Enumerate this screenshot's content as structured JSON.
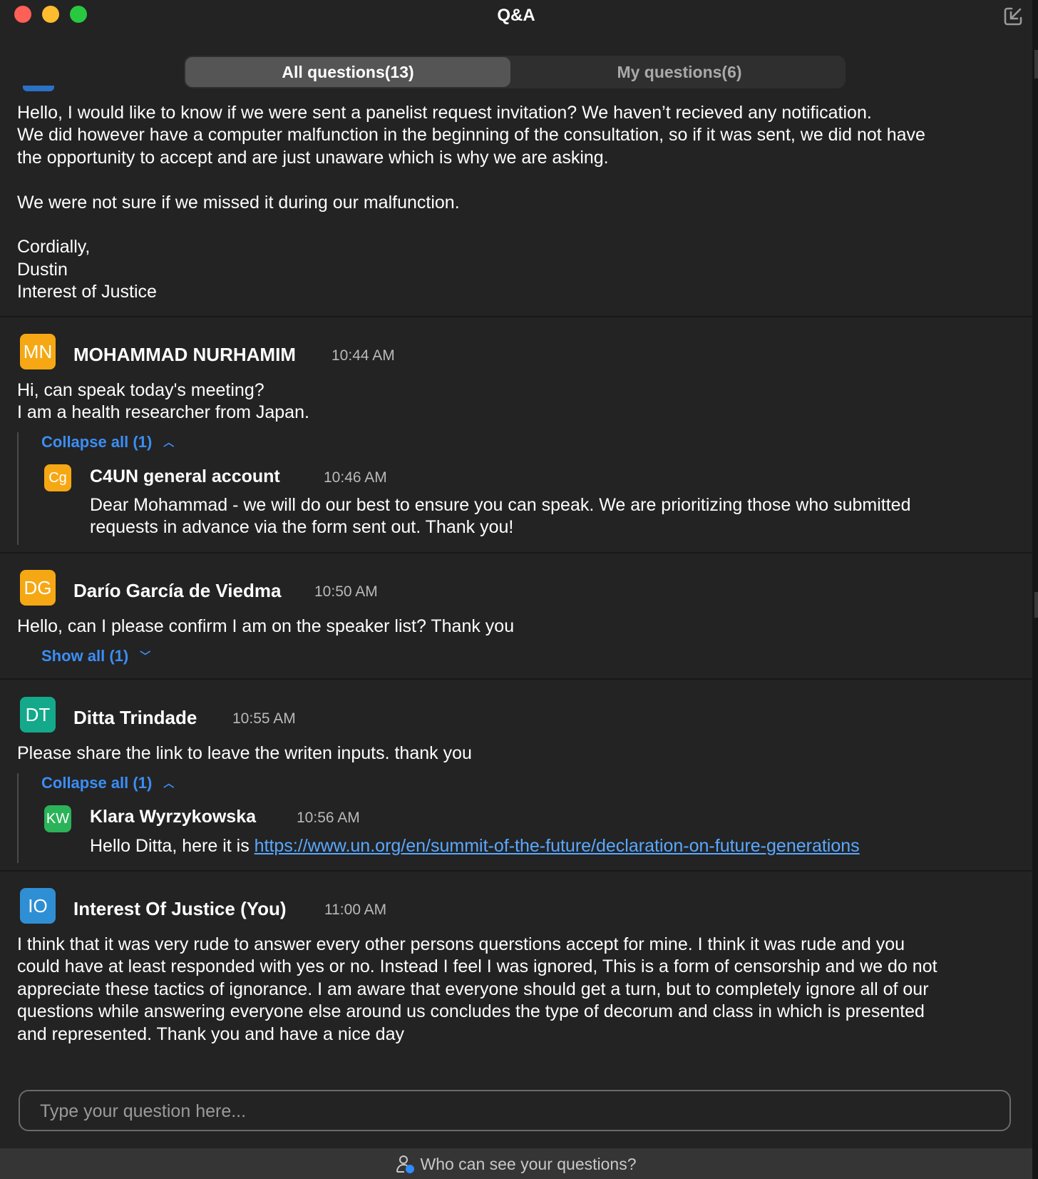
{
  "window": {
    "title": "Q&A",
    "traffic_lights": [
      "#fe5f57",
      "#febc2e",
      "#28c840"
    ],
    "popout_icon": "popout-arrow-icon"
  },
  "tabs": {
    "all": "All questions(13)",
    "mine": "My questions(6)"
  },
  "messages": [
    {
      "text": "Hello, I would like to know if we were sent a panelist request invitation? We haven’t recieved any notification.\nWe did however have a computer malfunction in the beginning of the consultation, so if it was sent, we did not have\nthe opportunity to accept and are just unaware which is why we are asking.\n\nWe were not sure if we missed it during our malfunction.\n\nCordially,\nDustin\nInterest of Justice"
    },
    {
      "initials": "MN",
      "color": "#f5a814",
      "name": "MOHAMMAD NURHAMIM",
      "time": "10:44 AM",
      "text": "Hi, can speak today's meeting?\nI am a health researcher from Japan.",
      "toggle": "Collapse all (1)",
      "reply": {
        "initials": "Cg",
        "color": "#f5a814",
        "name": "C4UN general account",
        "time": "10:46 AM",
        "text": "Dear Mohammad - we will do our best to ensure you can speak. We are prioritizing those who submitted\nrequests in advance via the form sent out. Thank you!"
      }
    },
    {
      "initials": "DG",
      "color": "#f5a814",
      "name": "Darío García de Viedma",
      "time": "10:50 AM",
      "text": "Hello, can I please confirm I am on the speaker list? Thank you",
      "toggle": "Show all (1)"
    },
    {
      "initials": "DT",
      "color": "#14a98b",
      "name": "Ditta Trindade",
      "time": "10:55 AM",
      "text": "Please share the link to leave the writen inputs. thank you",
      "toggle": "Collapse all (1)",
      "reply": {
        "initials": "KW",
        "color": "#2bb35a",
        "name": "Klara Wyrzykowska",
        "time": "10:56 AM",
        "text": "Hello Ditta, here it is ",
        "link": "https://www.un.org/en/summit-of-the-future/declaration-on-future-generations"
      }
    },
    {
      "initials": "IO",
      "color": "#2f8fd4",
      "name": "Interest Of Justice (You)",
      "time": "11:00 AM",
      "text": "I think that it was very rude to answer every other persons querstions accept for mine. I think it was rude and you\ncould have at least responded with yes or no. Instead I feel I was ignored, This is a form of censorship and we do not\nappreciate these tactics of ignorance. I am aware that everyone should get a turn, but to completely ignore all of our\nquestions while answering everyone else around us concludes the type of decorum and class in which is presented\nand represented. Thank you and have a nice day"
    }
  ],
  "input": {
    "placeholder": "Type your question here..."
  },
  "footer": {
    "label": "Who can see your questions?",
    "icon": "person-visibility-icon"
  },
  "accent": "#3b8ef5"
}
